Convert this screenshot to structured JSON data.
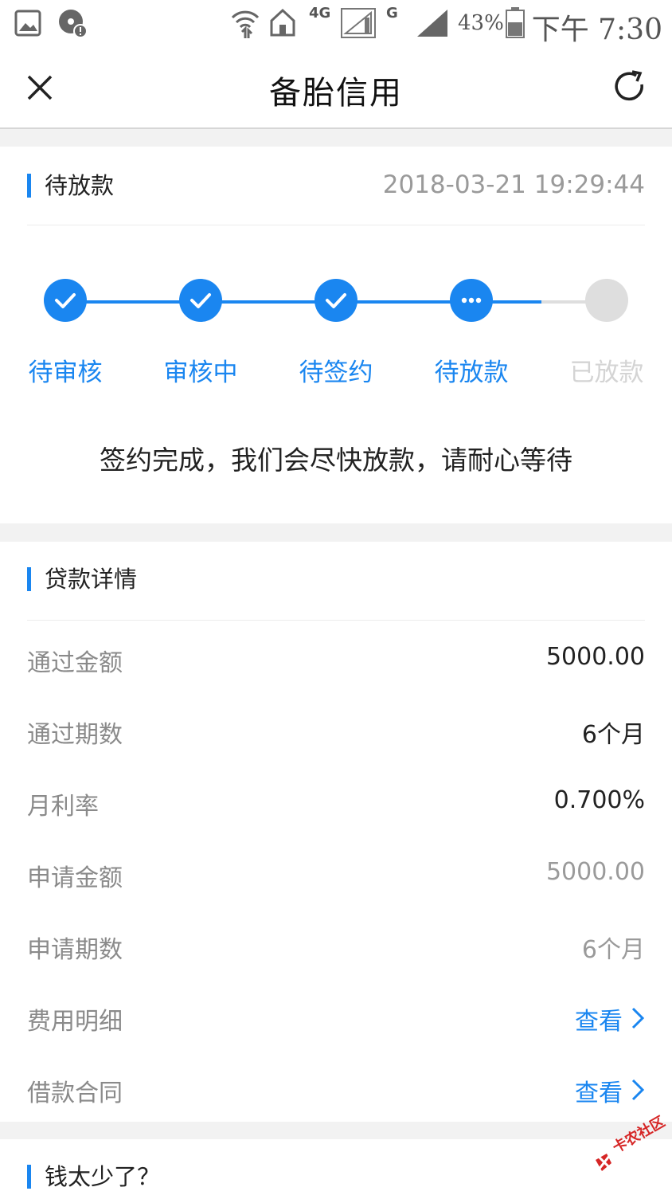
{
  "status_bar": {
    "network_1": "4G",
    "network_2": "G",
    "battery": "43%",
    "time": "下午 7:30"
  },
  "header": {
    "title": "备胎信用"
  },
  "progress": {
    "title": "待放款",
    "timestamp": "2018-03-21 19:29:44",
    "steps": [
      {
        "label": "待审核",
        "state": "done"
      },
      {
        "label": "审核中",
        "state": "done"
      },
      {
        "label": "待签约",
        "state": "done"
      },
      {
        "label": "待放款",
        "state": "current"
      },
      {
        "label": "已放款",
        "state": "pending"
      }
    ],
    "message": "签约完成，我们会尽快放款，请耐心等待"
  },
  "loan_details": {
    "title": "贷款详情",
    "rows": [
      {
        "label": "通过金额",
        "value": "5000.00"
      },
      {
        "label": "通过期数",
        "value": "6个月"
      },
      {
        "label": "月利率",
        "value": "0.700%"
      },
      {
        "label": "申请金额",
        "value": "5000.00"
      },
      {
        "label": "申请期数",
        "value": "6个月"
      },
      {
        "label": "费用明细",
        "value": "查看"
      },
      {
        "label": "借款合同",
        "value": "查看"
      }
    ]
  },
  "bottom_section": {
    "title": "钱太少了？"
  },
  "watermark": {
    "text": "卡农社区"
  },
  "colors": {
    "accent": "#1a86f0",
    "pending": "#dedede",
    "background": "#f2f2f2"
  }
}
